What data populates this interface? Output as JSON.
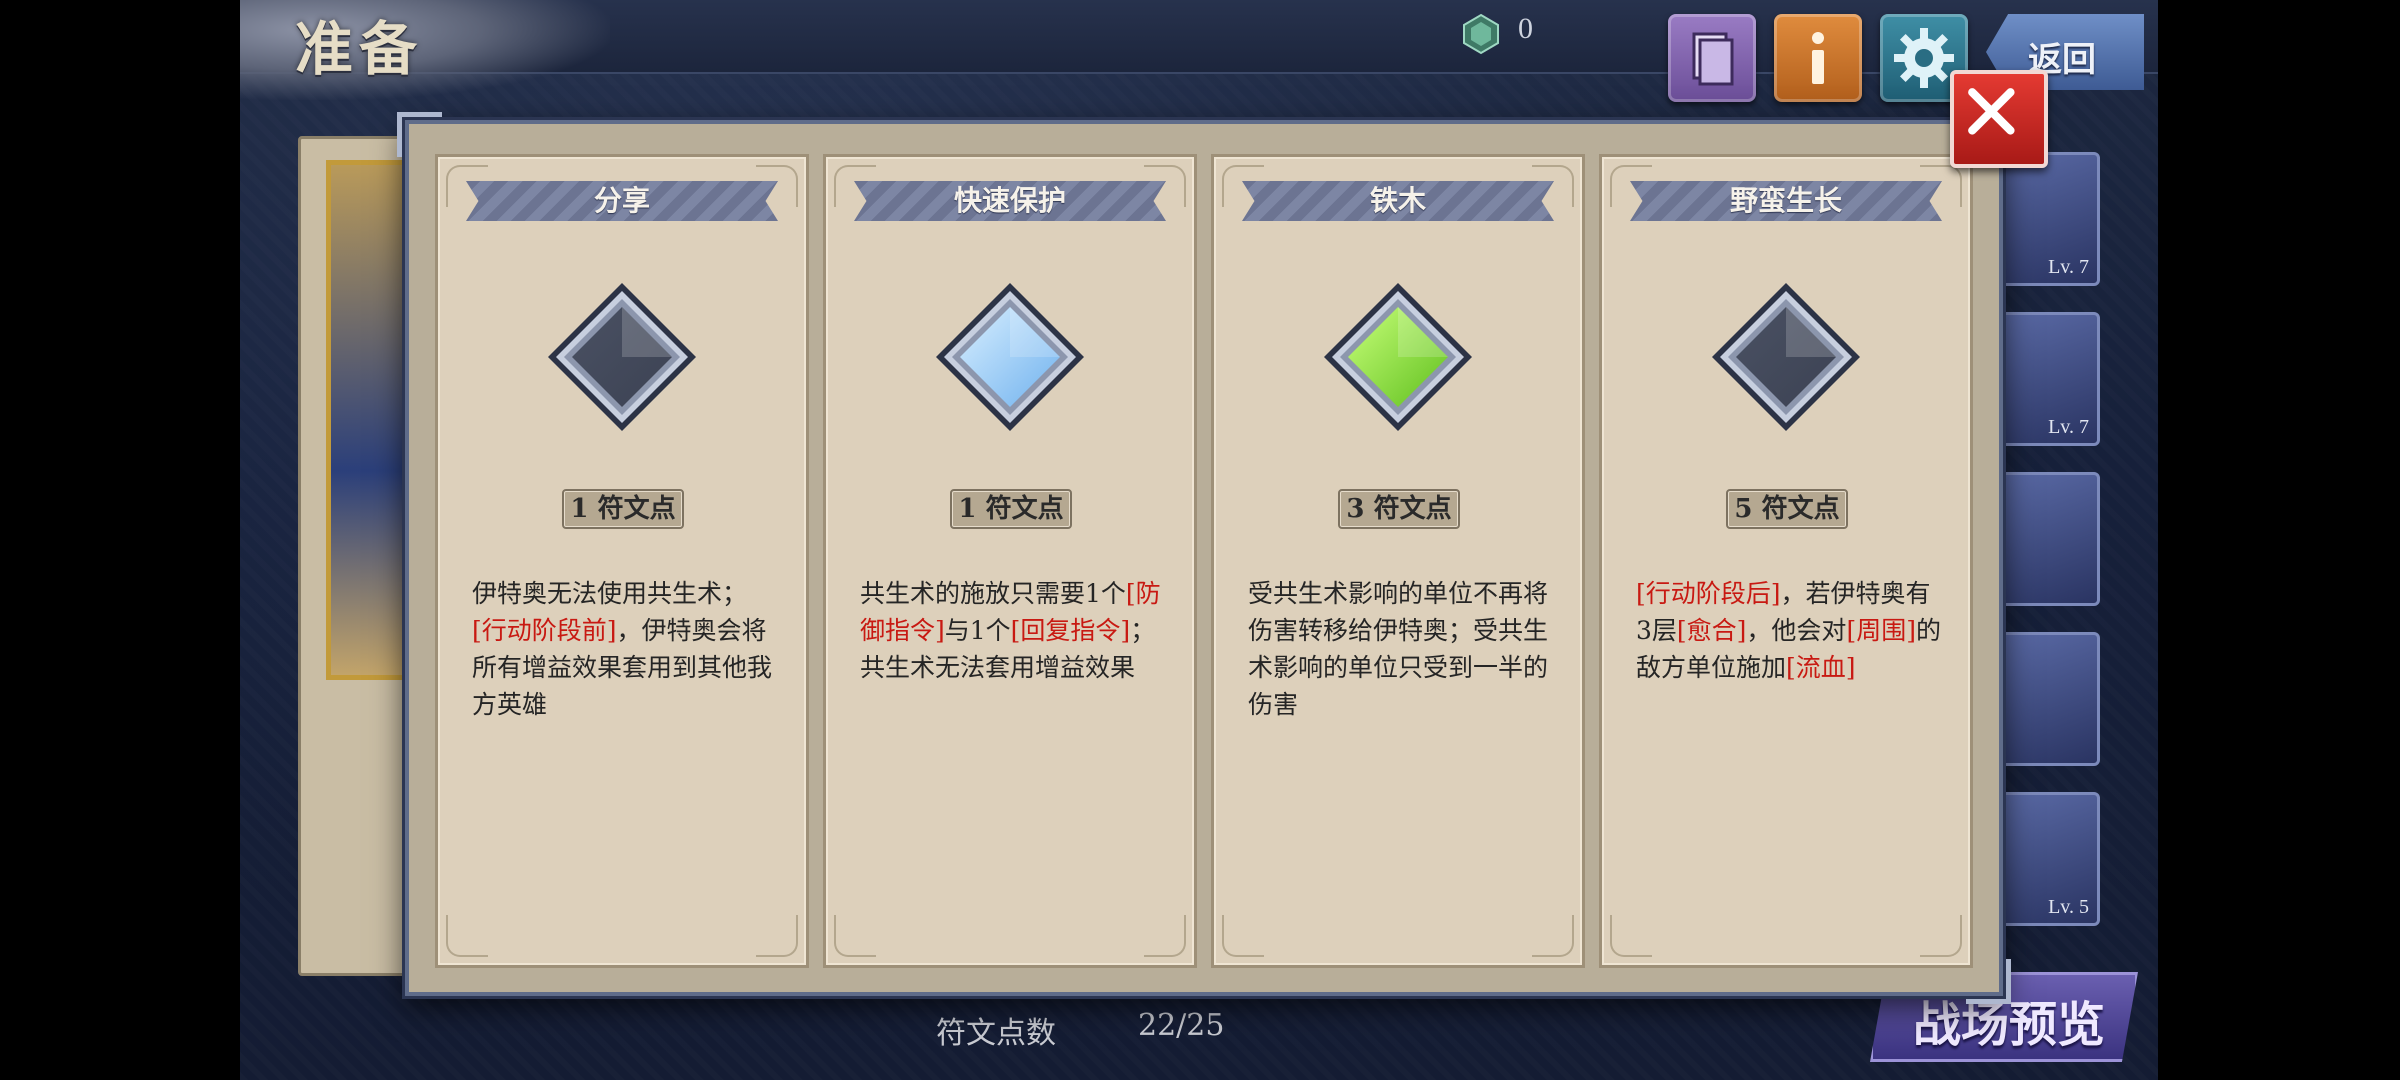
{
  "header": {
    "title": "准备",
    "currency_count": "0",
    "back_label": "返回",
    "icons": [
      "book-icon",
      "info-icon",
      "gear-icon"
    ]
  },
  "footer": {
    "rune_points_label": "符文点数",
    "rune_points_value": "22/25",
    "battle_preview_label": "战场预览"
  },
  "hero_levels": [
    "Lv. 7",
    "Lv. 7",
    "",
    "",
    "Lv. 5"
  ],
  "colors": {
    "highlight": "#c81912",
    "rune_empty": "#444b5c",
    "rune_blue": "#9fd2ff",
    "rune_green": "#8be33a"
  },
  "cards": [
    {
      "title": "分享",
      "rune": "empty",
      "cost": "1 符文点",
      "desc": [
        {
          "t": "伊特奥无法使用共生术；",
          "h": false
        },
        {
          "t": "[行动阶段前]",
          "h": true
        },
        {
          "t": "，伊特奥会将所有增益效果套用到其他我方英雄",
          "h": false
        }
      ]
    },
    {
      "title": "快速保护",
      "rune": "blue",
      "cost": "1 符文点",
      "desc": [
        {
          "t": "共生术的施放只需要1个",
          "h": false
        },
        {
          "t": "[防御指令]",
          "h": true
        },
        {
          "t": "与1个",
          "h": false
        },
        {
          "t": "[回复指令]",
          "h": true
        },
        {
          "t": "；共生术无法套用增益效果",
          "h": false
        }
      ]
    },
    {
      "title": "铁木",
      "rune": "green",
      "cost": "3 符文点",
      "desc": [
        {
          "t": "受共生术影响的单位不再将伤害转移给伊特奥；受共生术影响的单位只受到一半的伤害",
          "h": false
        }
      ]
    },
    {
      "title": "野蛮生长",
      "rune": "empty",
      "cost": "5 符文点",
      "desc": [
        {
          "t": "[行动阶段后]",
          "h": true
        },
        {
          "t": "，若伊特奥有3层",
          "h": false
        },
        {
          "t": "[愈合]",
          "h": true
        },
        {
          "t": "，他会对",
          "h": false
        },
        {
          "t": "[周围]",
          "h": true
        },
        {
          "t": "的敌方单位施加",
          "h": false
        },
        {
          "t": "[流血]",
          "h": true
        }
      ]
    }
  ]
}
